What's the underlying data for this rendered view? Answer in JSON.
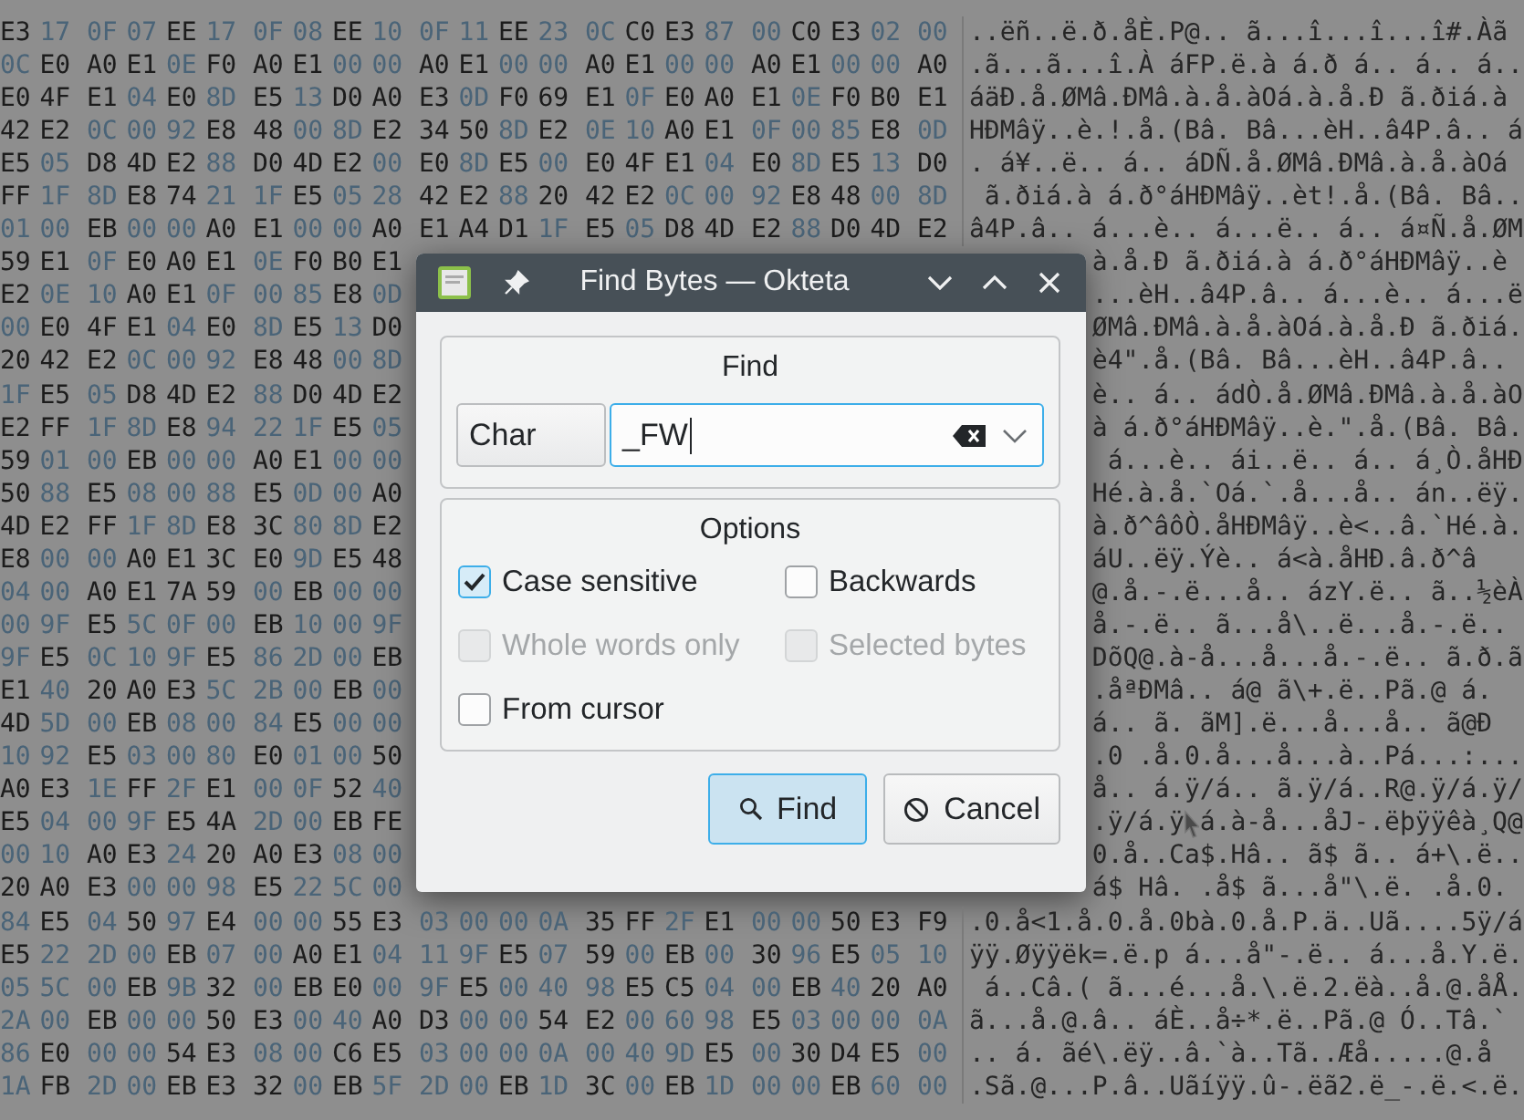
{
  "editor": {
    "rows_above": [
      {
        "bytes": "E3 17 0F 07 EE 17 0F 08 EE 10 0F 11 EE 23 0C C0 E3 87 00 C0 E3 02 00",
        "chars": "..ëñ..ë.ð.åÈ.P@.. ã...î...î...î#.Àã"
      },
      {
        "bytes": "0C E0 A0 E1 0E F0 A0 E1 00 00 A0 E1 00 00 A0 E1 00 00 A0 E1 00 00 A0",
        "chars": ".ã...ã...î.À áFP.ë.à á.ð á.. á.. á.."
      },
      {
        "bytes": "E0 4F E1 04 E0 8D E5 13 D0 A0 E3 0D F0 69 E1 0F E0 A0 E1 0E F0 B0 E1",
        "chars": "áäÐ.å.ØMâ.ÐMâ.à.å.àOá.à.å.Ð ã.ðiá.à"
      },
      {
        "bytes": "42 E2 0C 00 92 E8 48 00 8D E2 34 50 8D E2 0E 10 A0 E1 0F 00 85 E8 0D",
        "chars": "HÐMâÿ..è.!.å.(Bâ. Bâ...èH..â4P.â.. á"
      },
      {
        "bytes": "E5 05 D8 4D E2 88 D0 4D E2 00 E0 8D E5 00 E0 4F E1 04 E0 8D E5 13 D0",
        "chars": ". á¥..ë.. á.. áDÑ.å.ØMâ.ÐMâ.à.å.àOá"
      },
      {
        "bytes": "FF 1F 8D E8 74 21 1F E5 05 28 42 E2 88 20 42 E2 0C 00 92 E8 48 00 8D",
        "chars": " ã.ðiá.à á.ð°áHÐMâÿ..èt!.å.(Bâ. Bâ.."
      },
      {
        "bytes": "01 00 EB 00 00 A0 E1 00 00 A0 E1 A4 D1 1F E5 05 D8 4D E2 88 D0 4D E2",
        "chars": "â4P.â.. á...è.. á...ë.. á.. á¤Ñ.å.ØM"
      }
    ],
    "rows_beside": [
      {
        "bytes": "59 E1 0F E0 A0 E1 0E F0 B0 E1",
        "chars": "à.å.Ð ã.ðiá.à á.ð°áHÐMâÿ..è"
      },
      {
        "bytes": "E2 0E 10 A0 E1 0F 00 85 E8 0D",
        "chars": "...èH..â4P.â.. á...è.. á...ë"
      },
      {
        "bytes": "00 E0 4F E1 04 E0 8D E5 13 D0",
        "chars": "ØMâ.ÐMâ.à.å.àOá.à.å.Ð ã.ðiá."
      },
      {
        "bytes": "20 42 E2 0C 00 92 E8 48 00 8D",
        "chars": "è4\".å.(Bâ. Bâ...èH..â4P.â.."
      },
      {
        "bytes": "1F E5 05 D8 4D E2 88 D0 4D E2",
        "chars": "è.. á.. ádÒ.å.ØMâ.ÐMâ.à.å.àO"
      },
      {
        "bytes": "E2 FF 1F 8D E8 94 22 1F E5 05",
        "chars": "à á.ð°áHÐMâÿ..è.\".å.(Bâ. Bâ."
      },
      {
        "bytes": "59 01 00 EB 00 00 A0 E1 00 00",
        "chars": " á...è.. ái..ë.. á.. á¸Ò.åHÐ"
      },
      {
        "bytes": "50 88 E5 08 00 88 E5 0D 00 A0",
        "chars": "Hé.à.å.`Oá.`.å...å.. án..ëÿ."
      },
      {
        "bytes": "4D E2 FF 1F 8D E8 3C 80 8D E2",
        "chars": "à.ð^âôÒ.åHÐMâÿ..è<..â.`Hé.à."
      },
      {
        "bytes": "E8 00 00 A0 E1 3C E0 9D E5 48",
        "chars": "áU..ëÿ.Ýè.. á<à.åHÐ.â.ð^â"
      },
      {
        "bytes": "04 00 A0 E1 7A 59 00 EB 00 00",
        "chars": "@.å.-.ë...å.. ázY.ë.. ã..½èÀ"
      },
      {
        "bytes": "00 9F E5 5C 0F 00 EB 10 00 9F",
        "chars": "å.-.ë.. ã...å\\..ë...å.-.ë.."
      },
      {
        "bytes": "9F E5 0C 10 9F E5 86 2D 00 EB",
        "chars": "DõQ@.à-å...å...å.-.ë.. ã.ð.ã"
      },
      {
        "bytes": "E1 40 20 A0 E3 5C 2B 00 EB 00",
        "chars": ".åªÐMâ.. á@ ã\\+.ë..Pã.@ á."
      },
      {
        "bytes": "4D 5D 00 EB 08 00 84 E5 00 00",
        "chars": "á.. ã. ãM].ë...å...å.. ã@Ð"
      },
      {
        "bytes": "10 92 E5 03 00 80 E0 01 00 50",
        "chars": ".0 .å.0.å...å...à..Pá...:..."
      },
      {
        "bytes": "A0 E3 1E FF 2F E1 00 0F 52 40",
        "chars": "å.. á.ÿ/á.. ã.ÿ/á..R@.ÿ/á.ÿ/"
      },
      {
        "bytes": "E5 04 00 9F E5 4A 2D 00 EB FE",
        "chars": ".ÿ/á.ÿ",
        "chars_after_pointer": "á.à-å...åJ-.ëþÿÿêà¸Q@"
      },
      {
        "bytes": "00 10 A0 E3 24 20 A0 E3 08 00",
        "chars": "0.å..Ca$.Hâ.. ã$ ã.. á+\\.ë.."
      },
      {
        "bytes": "20 A0 E3 00 00 98 E5 22 5C 00",
        "chars": "á$ Hâ. .å$ ã...å\"\\.ë. .å.0."
      }
    ],
    "rows_below": [
      {
        "bytes": "84 E5 04 50 97 E4 00 00 55 E3 03 00 00 0A 35 FF 2F E1 00 00 50 E3 F9",
        "chars": ".0.å<1.å.0.å.0bà.0.å.P.ä..Uã....5ÿ/á"
      },
      {
        "bytes": "E5 22 2D 00 EB 07 00 A0 E1 04 11 9F E5 07 59 00 EB 00 30 96 E5 05 10",
        "chars": "ÿÿ.Øÿÿëk=.ë.p á...å\"-.ë.. á...å.Y.ë."
      },
      {
        "bytes": "05 5C 00 EB 9B 32 00 EB E0 00 9F E5 00 40 98 E5 C5 04 00 EB 40 20 A0",
        "chars": " á..Câ.( ã...é...å.\\.ë.2.ëà..å.@.åÅ."
      },
      {
        "bytes": "2A 00 EB 00 00 50 E3 00 40 A0 D3 00 00 54 E2 00 60 98 E5 03 00 00 0A",
        "chars": "ã...å.@.â.. áÈ..å÷*.ë..Pã.@ Ó..Tâ.`"
      },
      {
        "bytes": "86 E0 00 00 54 E3 08 00 C6 E5 03 00 00 0A 00 40 9D E5 00 30 D4 E5 00",
        "chars": ".. á. ãé\\.ëÿ..â.`à..Tã..Æå.....@.å"
      },
      {
        "bytes": "1A FB 2D 00 EB E3 32 00 EB 5F 2D 00 EB 1D 3C 00 EB 1D 00 00 EB 60 00",
        "chars": ".Sã.@...P.â..Uãíÿÿ.û-.ëã2.ë_-.ë.<.ë."
      }
    ]
  },
  "dialog": {
    "title": "Find Bytes — Okteta",
    "find_group": {
      "title": "Find",
      "format": "Char",
      "value": "_FW"
    },
    "options_group": {
      "title": "Options",
      "options": [
        {
          "label": "Case sensitive",
          "checked": true,
          "disabled": false
        },
        {
          "label": "Backwards",
          "checked": false,
          "disabled": false
        },
        {
          "label": "Whole words only",
          "checked": false,
          "disabled": true
        },
        {
          "label": "Selected bytes",
          "checked": false,
          "disabled": true
        },
        {
          "label": "From cursor",
          "checked": false,
          "disabled": false
        }
      ]
    },
    "buttons": [
      {
        "label": "Find",
        "default": true
      },
      {
        "label": "Cancel",
        "default": false
      }
    ]
  }
}
